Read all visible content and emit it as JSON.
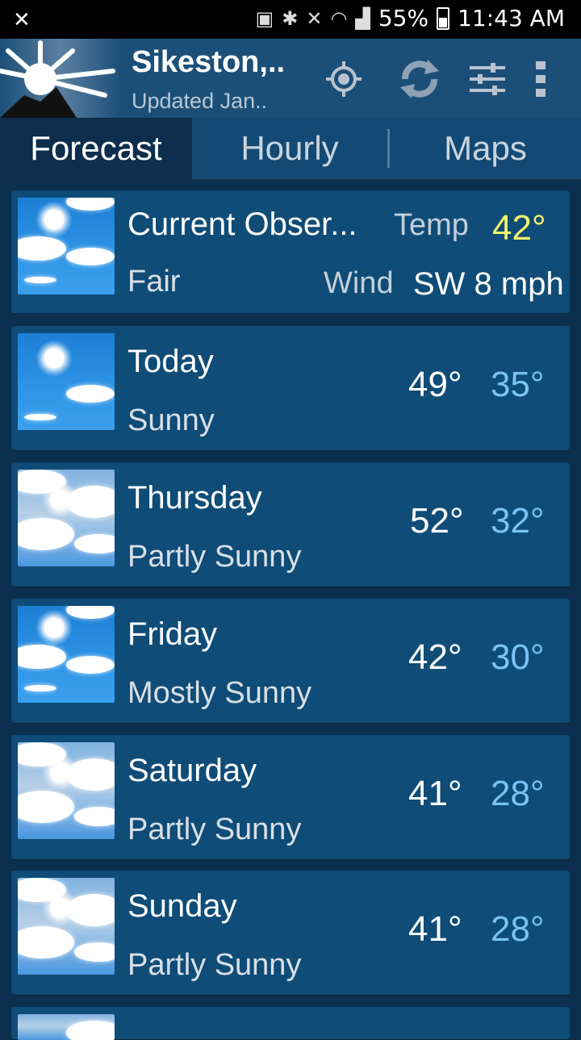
{
  "status_bar": {
    "battery": "55%",
    "time": "11:43 AM"
  },
  "app_bar": {
    "title": "Sikeston,..",
    "subtitle": "Updated Jan.."
  },
  "tabs": [
    "Forecast",
    "Hourly",
    "Maps"
  ],
  "current": {
    "title": "Current Obser...",
    "condition": "Fair",
    "temp_label": "Temp",
    "temp_value": "42°",
    "wind_label": "Wind",
    "wind_value": "SW 8 mph",
    "accent_color": "#f5f56a"
  },
  "forecast": [
    {
      "day": "Today",
      "condition": "Sunny",
      "high": "49°",
      "low": "35°",
      "icon": "sunny-icon"
    },
    {
      "day": "Thursday",
      "condition": "Partly Sunny",
      "high": "52°",
      "low": "32°",
      "icon": "partly-sunny-icon"
    },
    {
      "day": "Friday",
      "condition": "Mostly Sunny",
      "high": "42°",
      "low": "30°",
      "icon": "mostly-sunny-icon"
    },
    {
      "day": "Saturday",
      "condition": "Partly Sunny",
      "high": "41°",
      "low": "28°",
      "icon": "partly-sunny-icon"
    },
    {
      "day": "Sunday",
      "condition": "Partly Sunny",
      "high": "41°",
      "low": "28°",
      "icon": "partly-sunny-icon"
    }
  ],
  "colors": {
    "background": "#0b2f4d",
    "card": "#0f4c77",
    "low_temp": "#7cc2f2"
  }
}
